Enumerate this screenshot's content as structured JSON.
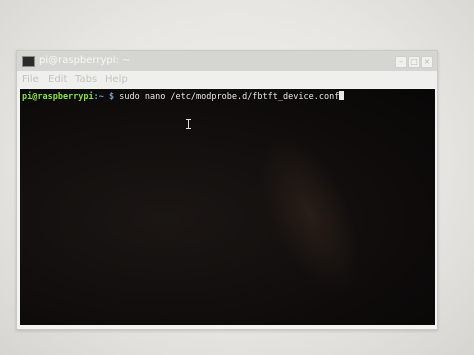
{
  "window": {
    "title": "pi@raspberrypi: ~",
    "icon": "terminal-icon",
    "controls": [
      "minimize-icon",
      "maximize-icon",
      "close-icon"
    ]
  },
  "menu": {
    "items": [
      {
        "label": "File"
      },
      {
        "label": "Edit"
      },
      {
        "label": "Tabs"
      },
      {
        "label": "Help"
      }
    ]
  },
  "terminal": {
    "prompt_user": "pi@raspberrypi",
    "prompt_sep": ":",
    "prompt_path": "~ $",
    "command": " sudo nano /etc/modprobe.d/fbtft_device.conf",
    "colors": {
      "background": "#0d0b0a",
      "prompt_user": "#8ae234",
      "prompt_path": "#729fcf",
      "text": "#e8e8e8"
    }
  }
}
